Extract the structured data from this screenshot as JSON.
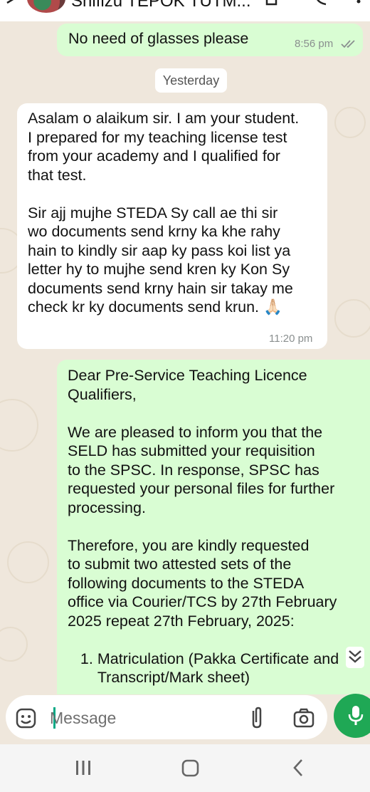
{
  "header": {
    "contact_name": "Shifizu TEPOK TUTM..."
  },
  "messages": [
    {
      "type": "outgoing",
      "text": "No need of glasses please",
      "time": "8:56 pm",
      "status": "read"
    },
    {
      "type": "date",
      "text": "Yesterday"
    },
    {
      "type": "incoming",
      "text": "Asalam o alaikum sir. I am your student.\nI prepared for my teaching license test\nfrom your academy and I qualified for\nthat test.\n\nSir ajj mujhe STEDA Sy call ae thi sir\nwo documents send krny ka khe rahy\nhain to kindly sir aap ky pass koi list ya\nletter hy to mujhe send kren ky Kon Sy\ndocuments send krny hain sir takay me\ncheck kr ky documents send krun. 🙏🏻",
      "time": "11:20 pm"
    },
    {
      "type": "outgoing",
      "text": "Dear Pre-Service Teaching Licence\nQualifiers,\n\nWe are pleased to inform you that the\nSELD has submitted your requisition\nto the SPSC. In response, SPSC has\nrequested your personal files for further\nprocessing.\n\nTherefore, you are kindly requested\nto submit two attested sets of the\nfollowing documents to the STEDA\noffice via Courier/TCS by 27th February\n2025 repeat 27th February, 2025:\n\n   1. Matriculation (Pakka Certificate and\n       Transcript/Mark sheet)"
    }
  ],
  "composer": {
    "placeholder": "Message"
  },
  "icons": {
    "sticker": "sticker-icon",
    "attach": "paperclip-icon",
    "camera": "camera-icon",
    "mic": "microphone-icon",
    "scroll": "double-chevron-down-icon",
    "nav_recents": "recents-icon",
    "nav_home": "home-icon",
    "nav_back": "back-icon"
  },
  "colors": {
    "outgoing_bubble": "#d9fdd3",
    "incoming_bubble": "#ffffff",
    "accent": "#1fa855",
    "read_tick": "#8a8f8f"
  }
}
